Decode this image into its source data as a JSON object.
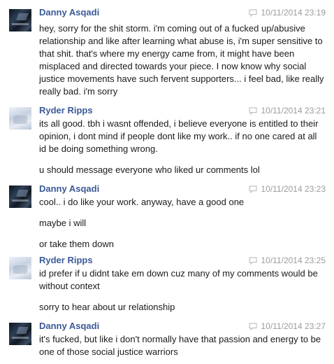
{
  "messages": [
    {
      "sender": "Danny Asqadi",
      "timestamp": "10/11/2014 23:19",
      "avatar": "dark",
      "paragraphs": [
        "hey, sorry for the shit storm. i'm coming out of a fucked up/abusive relationship and like after learning what abuse is, i'm super sensitive to that shit. that's where my energy came from, it might have been misplaced and directed towards your piece. I now know why social justice movements have such fervent supporters... i feel bad, like really really bad. i'm sorry"
      ]
    },
    {
      "sender": "Ryder Ripps",
      "timestamp": "10/11/2014 23:21",
      "avatar": "light",
      "paragraphs": [
        "its all good. tbh i wasnt offended, i believe everyone is entitled to their opinion, i dont mind if people dont like my work.. if no one cared at all id be doing something wrong.",
        "u should message everyone who liked ur comments lol"
      ]
    },
    {
      "sender": "Danny Asqadi",
      "timestamp": "10/11/2014 23:23",
      "avatar": "dark",
      "paragraphs": [
        "cool.. i do like your work. anyway, have a good one",
        "maybe i will",
        "or take them down"
      ]
    },
    {
      "sender": "Ryder Ripps",
      "timestamp": "10/11/2014 23:25",
      "avatar": "light",
      "paragraphs": [
        "id prefer if u didnt take em down cuz many of my comments would be without context",
        "sorry to hear about ur relationship"
      ]
    },
    {
      "sender": "Danny Asqadi",
      "timestamp": "10/11/2014 23:27",
      "avatar": "dark",
      "paragraphs": [
        "it's fucked, but like i don't normally have that passion and energy to be one of those social justice warriors"
      ]
    }
  ],
  "icons": {
    "timestamp_icon": "chat-bubble-icon"
  },
  "colors": {
    "sender_name": "#3b5998",
    "timestamp": "#9b9b9b",
    "message_text": "#1a1a1a",
    "background": "#ffffff"
  }
}
